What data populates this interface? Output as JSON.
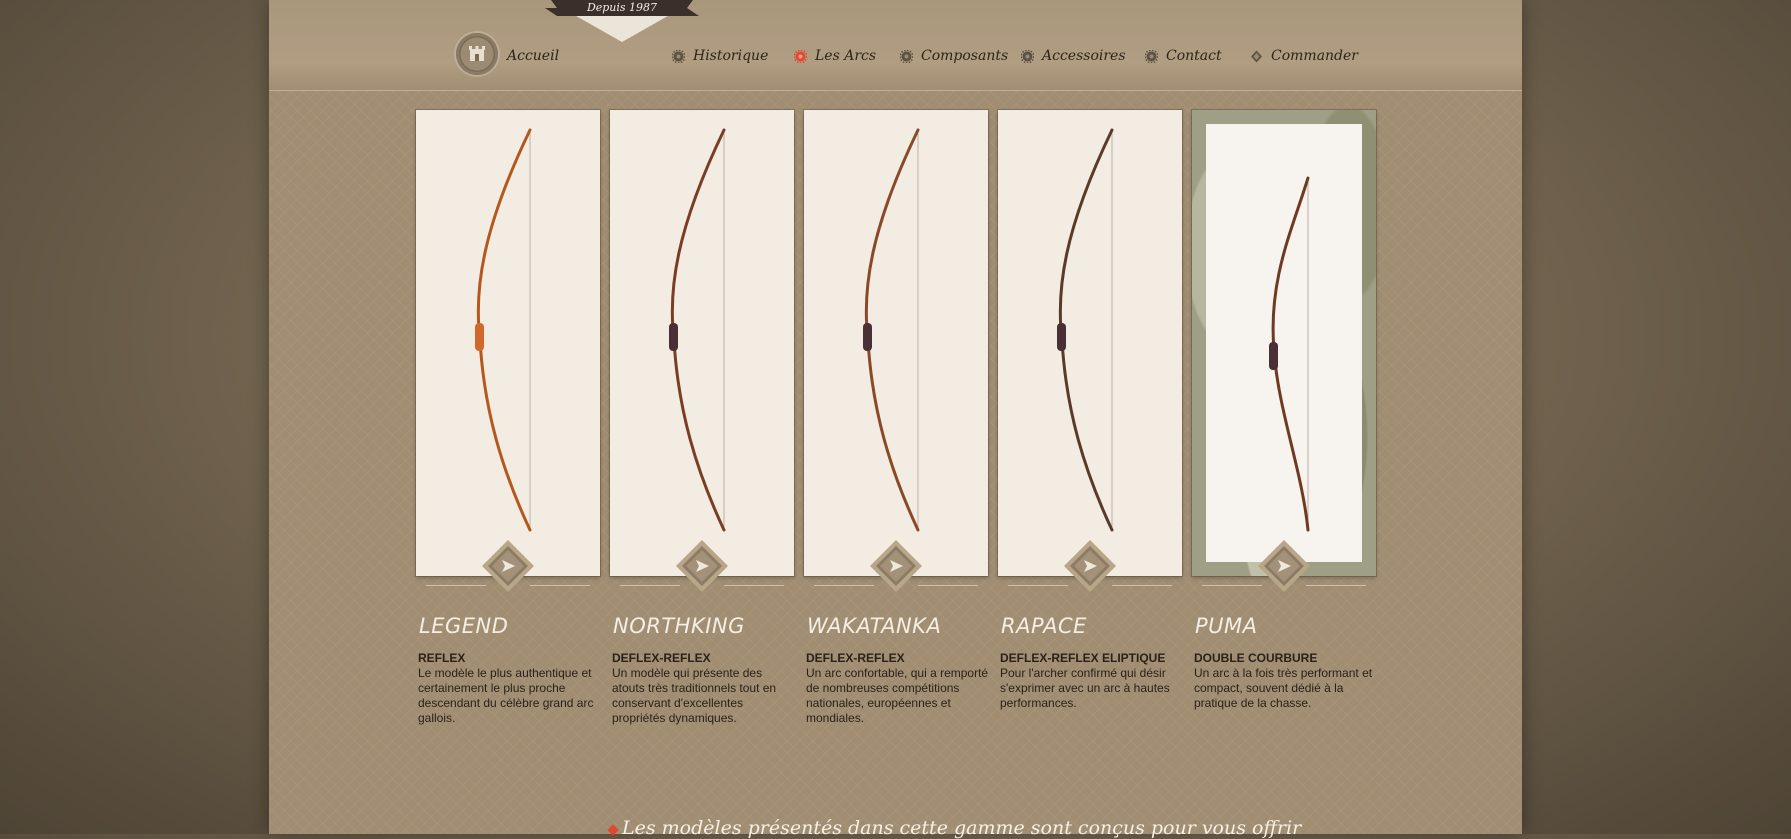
{
  "header": {
    "badge_text": "Depuis 1987",
    "home_label": "Accueil",
    "nav": [
      {
        "label": "Historique",
        "active": false
      },
      {
        "label": "Les Arcs",
        "active": true
      },
      {
        "label": "Composants",
        "active": false
      },
      {
        "label": "Accessoires",
        "active": false
      },
      {
        "label": "Contact",
        "active": false
      },
      {
        "label": "Commander",
        "active": false
      }
    ]
  },
  "colors": {
    "active_accent": "#e0482f",
    "gear_inactive": "#5e5244",
    "title_text": "#f4eee4"
  },
  "bows": [
    {
      "name": "LEGEND",
      "type": "REFLEX",
      "description": "Le modèle le plus authentique et certainement le plus proche descendant du célèbre grand arc gallois.",
      "wood": "#b4581f"
    },
    {
      "name": "NORTHKING",
      "type": "DEFLEX-REFLEX",
      "description": "Un modèle qui présente des atouts très traditionnels tout en conservant d'excellentes propriétés dynamiques.",
      "wood": "#7a3e24"
    },
    {
      "name": "WAKATANKA",
      "type": "DEFLEX-REFLEX",
      "description": "Un arc confortable, qui a remporté de nombreuses compétitions nationales, européennes et mondiales.",
      "wood": "#8a4a28"
    },
    {
      "name": "RAPACE",
      "type": "DEFLEX-REFLEX ELIPTIQUE",
      "description": "Pour l'archer confirmé qui désir s'exprimer avec un arc à hautes performances.",
      "wood": "#5a3a28"
    },
    {
      "name": "PUMA",
      "type": "DOUBLE COURBURE",
      "description": "Un arc à la fois très performant et compact, souvent dédié à la pratique de la chasse.",
      "wood": "#6e3a22"
    }
  ],
  "footer": {
    "text": "Les modèles présentés dans cette gamme sont conçus pour vous offrir"
  }
}
